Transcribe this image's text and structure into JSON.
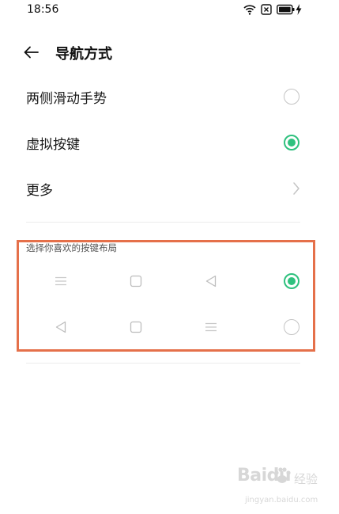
{
  "status_bar": {
    "time": "18:56",
    "icons": [
      "wifi-icon",
      "sim-x-icon",
      "battery-icon",
      "charging-bolt-icon"
    ]
  },
  "header": {
    "title": "导航方式",
    "back_icon": "arrow-left-icon"
  },
  "options": [
    {
      "label": "两侧滑动手势",
      "control": "radio",
      "selected": false
    },
    {
      "label": "虚拟按键",
      "control": "radio",
      "selected": true
    },
    {
      "label": "更多",
      "control": "chevron",
      "icon": "chevron-right-icon"
    }
  ],
  "layout_section": {
    "caption": "选择你喜欢的按键布局",
    "layouts": [
      {
        "icons": [
          "menu-icon",
          "square-icon",
          "back-triangle-icon"
        ],
        "selected": true
      },
      {
        "icons": [
          "back-triangle-icon",
          "square-icon",
          "menu-icon"
        ],
        "selected": false
      }
    ]
  },
  "colors": {
    "accent": "#2fc17e",
    "highlight_border": "#e5704a",
    "radio_border": "#c4c4c4",
    "icon_gray": "#c8c8c8"
  },
  "watermark": {
    "logo": "Baidu",
    "suffix": "经验",
    "url": "jingyan.baidu.com"
  }
}
